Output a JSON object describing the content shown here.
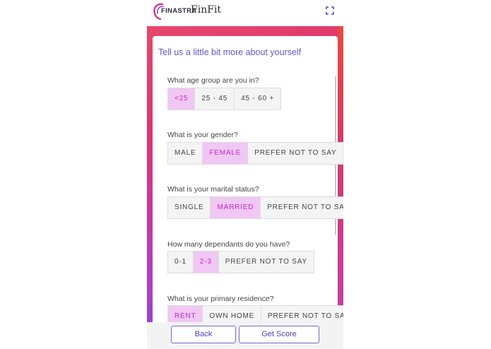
{
  "header": {
    "brand": "FINASTRA",
    "app_name": "FinFit"
  },
  "card": {
    "title": "Tell us a little bit more about yourself"
  },
  "questions": [
    {
      "label": "What age group are you in?",
      "options": [
        "<25",
        "25 - 45",
        "45 - 60 +"
      ],
      "selected": "<25"
    },
    {
      "label": "What is your gender?",
      "options": [
        "MALE",
        "FEMALE",
        "PREFER NOT TO SAY"
      ],
      "selected": "FEMALE"
    },
    {
      "label": "What is your marital status?",
      "options": [
        "SINGLE",
        "MARRIED",
        "PREFER NOT TO SAY"
      ],
      "selected": "MARRIED"
    },
    {
      "label": "How many dependants do you have?",
      "options": [
        "0-1",
        "2-3",
        "PREFER NOT TO SAY"
      ],
      "selected": "2-3"
    },
    {
      "label": "What is your primary residence?",
      "options": [
        "RENT",
        "OWN HOME",
        "PREFER NOT TO SAY"
      ],
      "selected": "RENT"
    }
  ],
  "footer": {
    "back_label": "Back",
    "score_label": "Get Score"
  },
  "colors": {
    "accent": "#6a55c8",
    "selected_bg": "#f0c8f3",
    "selected_text": "#c925d0"
  }
}
